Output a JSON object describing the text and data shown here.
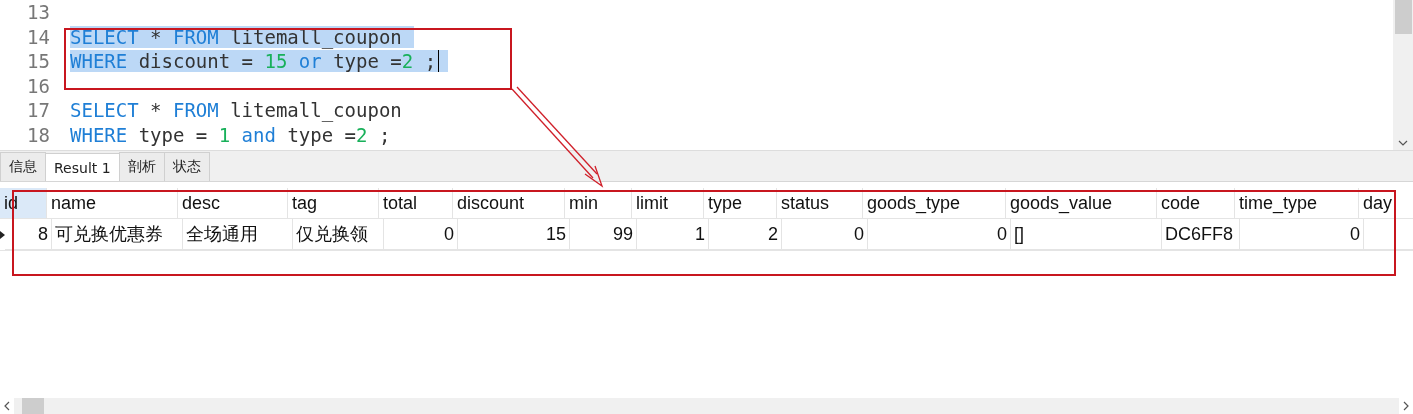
{
  "editor": {
    "lines": [
      {
        "number": "13",
        "selected": false,
        "caret": false
      },
      {
        "number": "14",
        "selected": true,
        "caret": false,
        "tokens": [
          {
            "kind": "keyword",
            "text": "SELECT"
          },
          {
            "kind": "text",
            "text": " * "
          },
          {
            "kind": "keyword",
            "text": "FROM"
          },
          {
            "kind": "text",
            "text": " litemall_coupon"
          }
        ]
      },
      {
        "number": "15",
        "selected": true,
        "caret": true,
        "tokens": [
          {
            "kind": "keyword",
            "text": "WHERE"
          },
          {
            "kind": "text",
            "text": " discount = "
          },
          {
            "kind": "number",
            "text": "15"
          },
          {
            "kind": "keyword",
            "text": " or"
          },
          {
            "kind": "text",
            "text": " type ="
          },
          {
            "kind": "number",
            "text": "2"
          },
          {
            "kind": "text",
            "text": " ;"
          }
        ]
      },
      {
        "number": "16",
        "selected": false,
        "caret": false
      },
      {
        "number": "17",
        "selected": false,
        "caret": false,
        "tokens": [
          {
            "kind": "keyword",
            "text": "SELECT"
          },
          {
            "kind": "text",
            "text": " * "
          },
          {
            "kind": "keyword",
            "text": "FROM"
          },
          {
            "kind": "text",
            "text": " litemall_coupon"
          }
        ]
      },
      {
        "number": "18",
        "selected": false,
        "caret": false,
        "tokens": [
          {
            "kind": "keyword",
            "text": "WHERE"
          },
          {
            "kind": "text",
            "text": " type = "
          },
          {
            "kind": "number",
            "text": "1"
          },
          {
            "kind": "keyword",
            "text": " and"
          },
          {
            "kind": "text",
            "text": " type ="
          },
          {
            "kind": "number",
            "text": "2"
          },
          {
            "kind": "text",
            "text": " ;"
          }
        ]
      }
    ]
  },
  "tabs": [
    {
      "label": "信息",
      "selected": false
    },
    {
      "label": "Result 1",
      "selected": true
    },
    {
      "label": "剖析",
      "selected": false
    },
    {
      "label": "状态",
      "selected": false
    }
  ],
  "table": {
    "columns": [
      {
        "name": "id",
        "kind": "number",
        "selected": true
      },
      {
        "name": "name",
        "kind": "text",
        "selected": false
      },
      {
        "name": "desc",
        "kind": "text",
        "selected": false
      },
      {
        "name": "tag",
        "kind": "text",
        "selected": false
      },
      {
        "name": "total",
        "kind": "number",
        "selected": false
      },
      {
        "name": "discount",
        "kind": "number",
        "selected": false
      },
      {
        "name": "min",
        "kind": "number",
        "selected": false
      },
      {
        "name": "limit",
        "kind": "number",
        "selected": false
      },
      {
        "name": "type",
        "kind": "number",
        "selected": false
      },
      {
        "name": "status",
        "kind": "number",
        "selected": false
      },
      {
        "name": "goods_type",
        "kind": "number",
        "selected": false
      },
      {
        "name": "goods_value",
        "kind": "text",
        "selected": false
      },
      {
        "name": "code",
        "kind": "text",
        "selected": false
      },
      {
        "name": "time_type",
        "kind": "number",
        "selected": false
      },
      {
        "name": "day",
        "kind": "number",
        "selected": false
      }
    ],
    "rows": [
      {
        "current": true,
        "cells": [
          "8",
          "可兑换优惠券",
          "全场通用",
          "仅兑换领",
          "0",
          "15",
          "99",
          "1",
          "2",
          "0",
          "0",
          "[]",
          "DC6FF8",
          "0"
        ]
      }
    ]
  }
}
